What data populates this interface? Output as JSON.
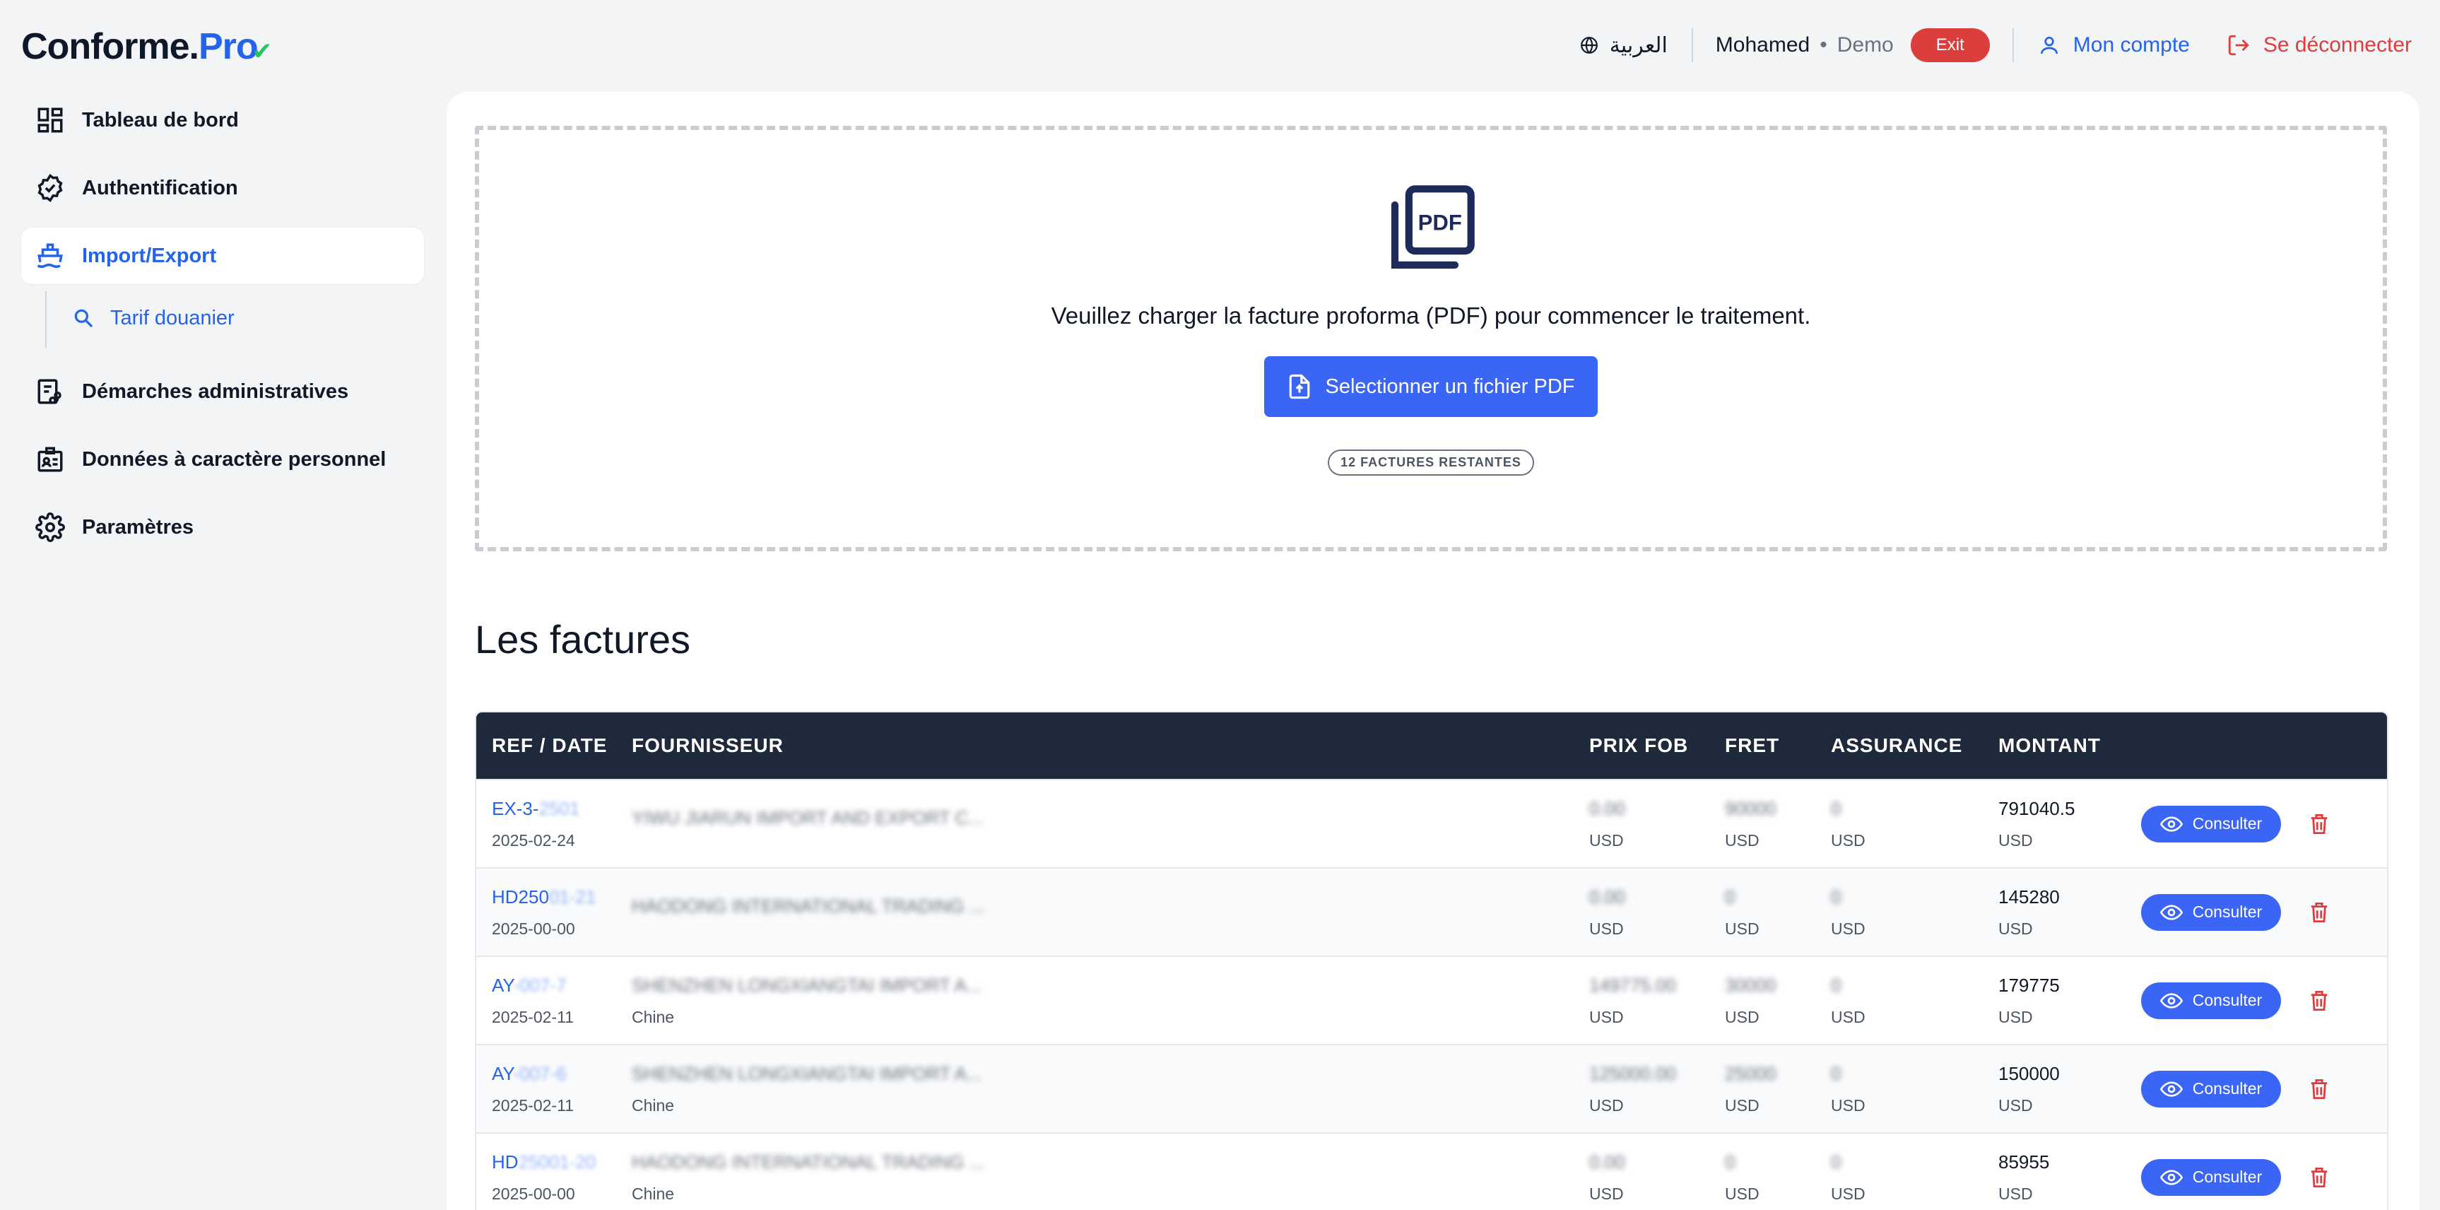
{
  "brand": {
    "part1": "Conforme.",
    "part2": "Pro"
  },
  "header": {
    "language": "العربية",
    "user_name": "Mohamed",
    "separator": "•",
    "user_role": "Demo",
    "exit_label": "Exit",
    "account_label": "Mon compte",
    "logout_label": "Se déconnecter"
  },
  "sidebar": {
    "items": [
      {
        "label": "Tableau de bord",
        "icon": "dashboard-icon"
      },
      {
        "label": "Authentification",
        "icon": "badge-check-icon"
      },
      {
        "label": "Import/Export",
        "icon": "ship-icon"
      },
      {
        "label": "Démarches administratives",
        "icon": "workflow-icon"
      },
      {
        "label": "Données à caractère personnel",
        "icon": "id-card-icon"
      },
      {
        "label": "Paramètres",
        "icon": "gear-icon"
      }
    ],
    "sub_item": {
      "label": "Tarif douanier",
      "icon": "search-icon"
    }
  },
  "upload": {
    "instruction": "Veuillez charger la facture proforma (PDF) pour commencer le traitement.",
    "button_label": "Selectionner un fichier PDF",
    "remaining": "12 FACTURES RESTANTES"
  },
  "invoices": {
    "title": "Les factures",
    "columns": [
      "REF / DATE",
      "FOURNISSEUR",
      "PRIX FOB",
      "FRET",
      "ASSURANCE",
      "MONTANT"
    ],
    "action_label": "Consulter",
    "rows": [
      {
        "ref_a": "EX-3-",
        "ref_b": "2501",
        "date": "2025-02-24",
        "supplier": "YIWU JIARUN IMPORT AND EXPORT C...",
        "country": "",
        "fob": "0.00",
        "fret": "90000",
        "assurance": "0",
        "montant": "791040.5",
        "currency": "USD"
      },
      {
        "ref_a": "HD250",
        "ref_b": "01-21",
        "date": "2025-00-00",
        "supplier": "HAODONG INTERNATIONAL TRADING ...",
        "country": "",
        "fob": "0.00",
        "fret": "0",
        "assurance": "0",
        "montant": "145280",
        "currency": "USD"
      },
      {
        "ref_a": "AY",
        "ref_b": "-007-7",
        "date": "2025-02-11",
        "supplier": "SHENZHEN LONGXIANGTAI IMPORT A...",
        "country": "Chine",
        "fob": "149775.00",
        "fret": "30000",
        "assurance": "0",
        "montant": "179775",
        "currency": "USD"
      },
      {
        "ref_a": "AY",
        "ref_b": "-007-6",
        "date": "2025-02-11",
        "supplier": "SHENZHEN LONGXIANGTAI IMPORT A...",
        "country": "Chine",
        "fob": "125000.00",
        "fret": "25000",
        "assurance": "0",
        "montant": "150000",
        "currency": "USD"
      },
      {
        "ref_a": "HD",
        "ref_b": "25001-20",
        "date": "2025-00-00",
        "supplier": "HAODONG INTERNATIONAL TRADING ...",
        "country": "Chine",
        "fob": "0.00",
        "fret": "0",
        "assurance": "0",
        "montant": "85955",
        "currency": "USD"
      }
    ]
  },
  "colors": {
    "accent": "#2563eb",
    "button": "#3b66f5",
    "danger": "#dc3d3d",
    "table_header": "#1e293b",
    "check": "#22c55e"
  }
}
